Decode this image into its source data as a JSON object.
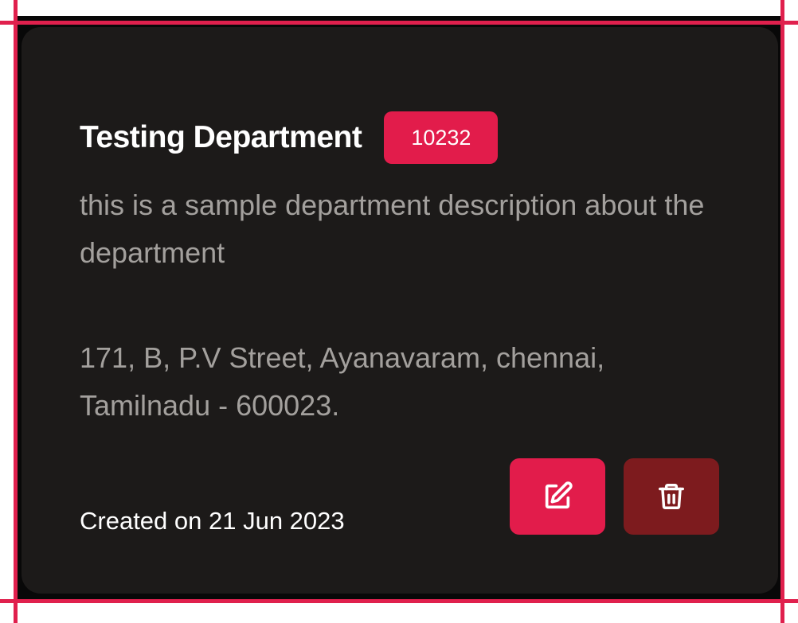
{
  "department": {
    "name": "Testing Department",
    "code": "10232",
    "description": "this is a sample department description about the department",
    "address": "171, B, P.V Street, Ayanavaram, chennai, Tamilnadu - 600023.",
    "created": "Created on 21 Jun 2023"
  },
  "actions": {
    "edit_icon": "edit-icon",
    "delete_icon": "trash-icon"
  },
  "colors": {
    "accent": "#e21c4b",
    "delete": "#7d1b1e",
    "card_bg": "#1c1a19",
    "muted_text": "#a3a09d",
    "guide": "#e0204d"
  }
}
